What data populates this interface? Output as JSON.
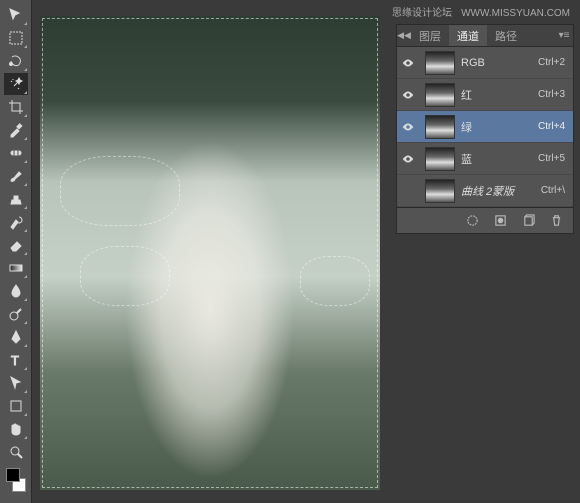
{
  "watermark": {
    "text": "思缘设计论坛",
    "url": "WWW.MISSYUAN.COM"
  },
  "panel": {
    "tabs": [
      {
        "id": "layers",
        "label": "图层"
      },
      {
        "id": "channels",
        "label": "通道"
      },
      {
        "id": "paths",
        "label": "路径"
      }
    ],
    "channels": [
      {
        "name": "RGB",
        "shortcut": "Ctrl+2",
        "visible": true
      },
      {
        "name": "红",
        "shortcut": "Ctrl+3",
        "visible": true
      },
      {
        "name": "绿",
        "shortcut": "Ctrl+4",
        "visible": true,
        "selected": true
      },
      {
        "name": "蓝",
        "shortcut": "Ctrl+5",
        "visible": true
      },
      {
        "name": "曲线 2蒙版",
        "shortcut": "Ctrl+\\",
        "visible": false
      }
    ]
  }
}
